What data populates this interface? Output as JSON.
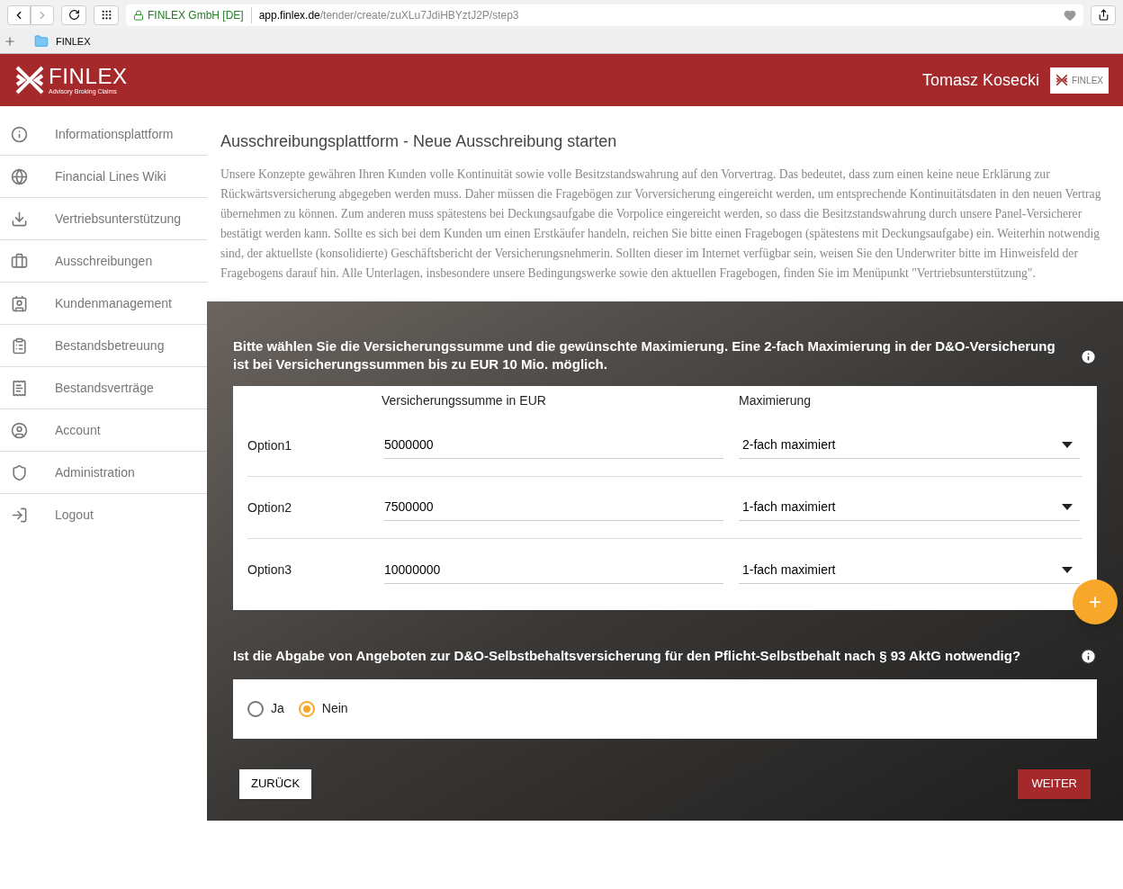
{
  "browser": {
    "site_identity": "FINLEX GmbH [DE]",
    "url_host": "app.finlex.de",
    "url_path": "/tender/create/zuXLu7JdiHBYztJ2P/step3",
    "bookmark": "FINLEX"
  },
  "header": {
    "logo_text": "FINLEX",
    "logo_tagline": "Advisory Broking Claims",
    "user_name": "Tomasz Kosecki",
    "badge_text": "FINLEX"
  },
  "sidebar": {
    "items": [
      {
        "label": "Informationsplattform",
        "kind": "info"
      },
      {
        "label": "Financial Lines Wiki",
        "kind": "globe"
      },
      {
        "label": "Vertriebsunterstützung",
        "kind": "download"
      },
      {
        "label": "Ausschreibungen",
        "kind": "briefcase"
      },
      {
        "label": "Kundenmanagement",
        "kind": "contact"
      },
      {
        "label": "Bestandsbetreuung",
        "kind": "clipboard"
      },
      {
        "label": "Bestandsverträge",
        "kind": "receipt"
      },
      {
        "label": "Account",
        "kind": "account"
      },
      {
        "label": "Administration",
        "kind": "shield"
      },
      {
        "label": "Logout",
        "kind": "logout"
      }
    ]
  },
  "page": {
    "title": "Ausschreibungsplattform - Neue Ausschreibung starten",
    "intro": "Unsere Konzepte gewähren Ihren Kunden volle Kontinuität sowie volle Besitzstandswahrung auf den Vorvertrag. Das bedeutet, dass zum einen keine neue Erklärung zur Rückwärtsversicherung abgegeben werden muss. Daher müssen die Fragebögen zur Vorversicherung eingereicht werden, um entsprechende Kontinuitätsdaten in den neuen Vertrag übernehmen zu können. Zum anderen muss spätestens bei Deckungsaufgabe die Vorpolice eingereicht werden, so dass die Besitzstandswahrung durch unsere Panel-Versicherer bestätigt werden kann. Sollte es sich bei dem Kunden um einen Erstkäufer handeln, reichen Sie bitte einen Fragebogen (spätestens mit Deckungsaufgabe) ein. Weiterhin notwendig sind, der aktuellste (konsolidierte) Geschäftsbericht der Versicherungsnehmerin. Sollten dieser im Internet verfügbar sein, weisen Sie den Underwriter bitte im Hinweisfeld der Fragebogens darauf hin. Alle Unterlagen, insbesondere unsere Bedingungswerke sowie den aktuellen Fragebogen, finden Sie im Menüpunkt \"Vertriebsunterstützung\"."
  },
  "question1": {
    "text": "Bitte wählen Sie die Versicherungssumme und die gewünschte Maximierung. Eine 2-fach Maximierung in der D&O-Versicherung ist bei Versicherungssummen bis zu EUR 10 Mio. möglich.",
    "columns": [
      "Versicherungssumme in EUR",
      "Maximierung"
    ],
    "rows": [
      {
        "label": "Option1",
        "sum": "5000000",
        "max": "2-fach maximiert"
      },
      {
        "label": "Option2",
        "sum": "7500000",
        "max": "1-fach maximiert"
      },
      {
        "label": "Option3",
        "sum": "10000000",
        "max": "1-fach maximiert"
      }
    ],
    "add_button": "+"
  },
  "question2": {
    "text": "Ist die Abgabe von Angeboten zur D&O-Selbstbehaltsversicherung für den Pflicht-Selbstbehalt nach § 93 AktG notwendig?",
    "options": [
      {
        "label": "Ja",
        "selected": false
      },
      {
        "label": "Nein",
        "selected": true
      }
    ]
  },
  "buttons": {
    "back": "ZURÜCK",
    "next": "WEITER"
  }
}
